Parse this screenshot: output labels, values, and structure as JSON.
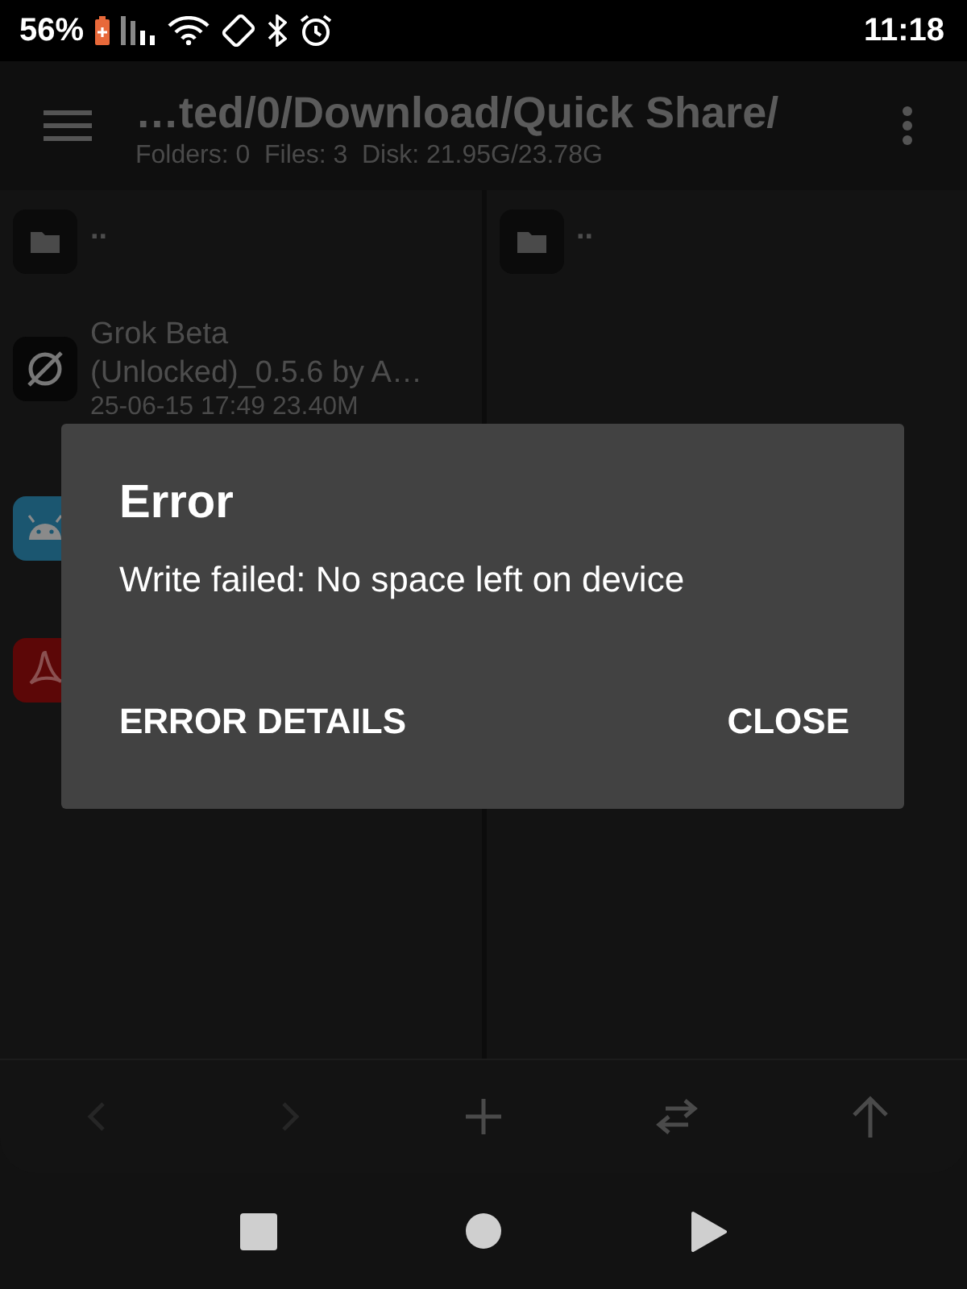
{
  "status_bar": {
    "battery": "56%",
    "time": "11:18"
  },
  "toolbar": {
    "path": "…ted/0/Download/Quick Share/",
    "summary": "Folders: 0  Files: 3  Disk: 21.95G/23.78G"
  },
  "left_panel": {
    "items": [
      {
        "kind": "folder",
        "name": ".."
      },
      {
        "kind": "app",
        "name": "Grok Beta (Unlocked)_0.5.6 by A…",
        "meta": "25-06-15 17:49  23.40M"
      },
      {
        "kind": "apk"
      },
      {
        "kind": "pdf"
      }
    ]
  },
  "right_panel": {
    "items": [
      {
        "kind": "folder",
        "name": ".."
      }
    ]
  },
  "bottom_bar": [
    {
      "kind": "back",
      "disabled": true
    },
    {
      "kind": "forward",
      "disabled": true
    },
    {
      "kind": "add",
      "disabled": false
    },
    {
      "kind": "swap",
      "disabled": false
    },
    {
      "kind": "up",
      "disabled": false
    }
  ],
  "dialog": {
    "title": "Error",
    "message": "Write failed: No space left on device",
    "buttons": [
      "ERROR DETAILS",
      "CLOSE"
    ]
  }
}
